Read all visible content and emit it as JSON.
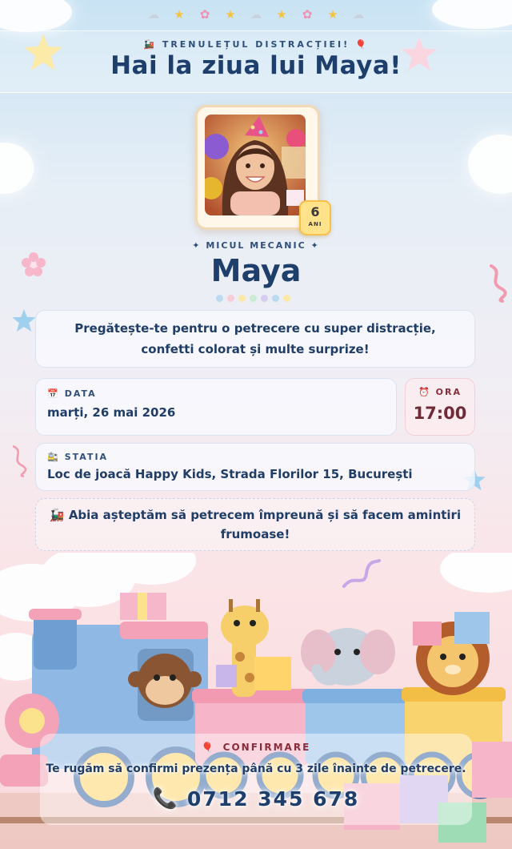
{
  "top_decor": [
    "☁",
    "★",
    "✿",
    "★",
    "☁",
    "★",
    "✿",
    "★",
    "☁"
  ],
  "header": {
    "kicker_icon": "🚂",
    "kicker": "TRENULEȚUL DISTRACȚIEI!",
    "kicker_icon_end": "🎈",
    "title": "Hai la ziua lui Maya!"
  },
  "profile": {
    "age": "6",
    "age_unit": "ANI",
    "subtitle": "✦ MICUL MECANIC ✦",
    "name": "Maya"
  },
  "colors": {
    "dots": [
      "#bcd9f2",
      "#f6cdd9",
      "#fbe7a6",
      "#c9ecd3",
      "#d7cdf0",
      "#bcd9f2",
      "#fbe7a6"
    ]
  },
  "intro": "Pregătește-te pentru o petrecere cu super distracție, confetti colorat și multe surprize!",
  "date": {
    "icon": "📅",
    "label": "DATA",
    "value": "marți, 26 mai 2026"
  },
  "time": {
    "icon": "⏰",
    "label": "ORA",
    "value": "17:00"
  },
  "station": {
    "icon": "🚉",
    "label": "STATIA",
    "value": "Loc de joacă Happy Kids, Strada Florilor 15, București"
  },
  "closing": {
    "icon": "🚂",
    "text": "Abia așteptăm să petrecem împreună și să facem amintiri frumoase!"
  },
  "rsvp": {
    "icon": "🎈",
    "label": "CONFIRMARE",
    "text": "Te rugăm să confirmi prezența până cu 3 zile înainte de petrecere.",
    "phone_icon": "📞",
    "phone": "0712 345 678"
  }
}
